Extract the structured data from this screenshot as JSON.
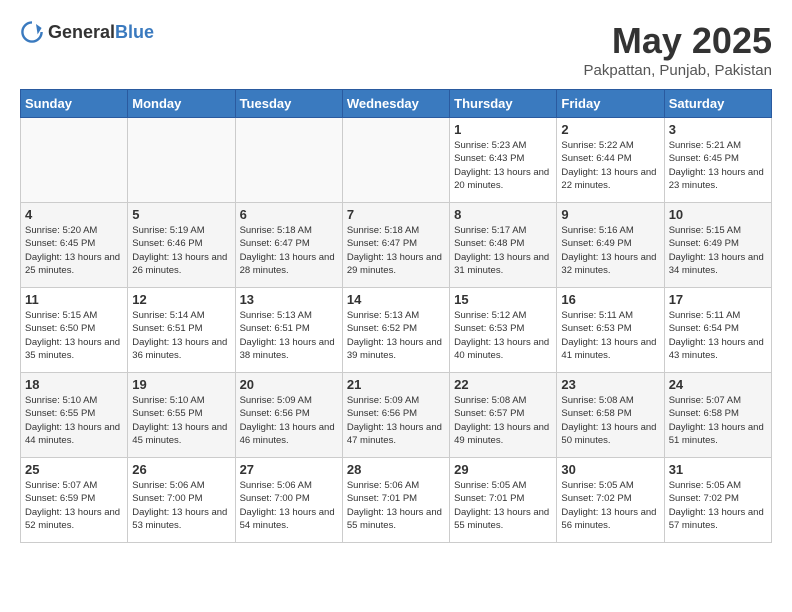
{
  "logo": {
    "general": "General",
    "blue": "Blue"
  },
  "title": {
    "month_year": "May 2025",
    "location": "Pakpattan, Punjab, Pakistan"
  },
  "headers": [
    "Sunday",
    "Monday",
    "Tuesday",
    "Wednesday",
    "Thursday",
    "Friday",
    "Saturday"
  ],
  "weeks": [
    [
      {
        "day": "",
        "info": ""
      },
      {
        "day": "",
        "info": ""
      },
      {
        "day": "",
        "info": ""
      },
      {
        "day": "",
        "info": ""
      },
      {
        "day": "1",
        "info": "Sunrise: 5:23 AM\nSunset: 6:43 PM\nDaylight: 13 hours and 20 minutes."
      },
      {
        "day": "2",
        "info": "Sunrise: 5:22 AM\nSunset: 6:44 PM\nDaylight: 13 hours and 22 minutes."
      },
      {
        "day": "3",
        "info": "Sunrise: 5:21 AM\nSunset: 6:45 PM\nDaylight: 13 hours and 23 minutes."
      }
    ],
    [
      {
        "day": "4",
        "info": "Sunrise: 5:20 AM\nSunset: 6:45 PM\nDaylight: 13 hours and 25 minutes."
      },
      {
        "day": "5",
        "info": "Sunrise: 5:19 AM\nSunset: 6:46 PM\nDaylight: 13 hours and 26 minutes."
      },
      {
        "day": "6",
        "info": "Sunrise: 5:18 AM\nSunset: 6:47 PM\nDaylight: 13 hours and 28 minutes."
      },
      {
        "day": "7",
        "info": "Sunrise: 5:18 AM\nSunset: 6:47 PM\nDaylight: 13 hours and 29 minutes."
      },
      {
        "day": "8",
        "info": "Sunrise: 5:17 AM\nSunset: 6:48 PM\nDaylight: 13 hours and 31 minutes."
      },
      {
        "day": "9",
        "info": "Sunrise: 5:16 AM\nSunset: 6:49 PM\nDaylight: 13 hours and 32 minutes."
      },
      {
        "day": "10",
        "info": "Sunrise: 5:15 AM\nSunset: 6:49 PM\nDaylight: 13 hours and 34 minutes."
      }
    ],
    [
      {
        "day": "11",
        "info": "Sunrise: 5:15 AM\nSunset: 6:50 PM\nDaylight: 13 hours and 35 minutes."
      },
      {
        "day": "12",
        "info": "Sunrise: 5:14 AM\nSunset: 6:51 PM\nDaylight: 13 hours and 36 minutes."
      },
      {
        "day": "13",
        "info": "Sunrise: 5:13 AM\nSunset: 6:51 PM\nDaylight: 13 hours and 38 minutes."
      },
      {
        "day": "14",
        "info": "Sunrise: 5:13 AM\nSunset: 6:52 PM\nDaylight: 13 hours and 39 minutes."
      },
      {
        "day": "15",
        "info": "Sunrise: 5:12 AM\nSunset: 6:53 PM\nDaylight: 13 hours and 40 minutes."
      },
      {
        "day": "16",
        "info": "Sunrise: 5:11 AM\nSunset: 6:53 PM\nDaylight: 13 hours and 41 minutes."
      },
      {
        "day": "17",
        "info": "Sunrise: 5:11 AM\nSunset: 6:54 PM\nDaylight: 13 hours and 43 minutes."
      }
    ],
    [
      {
        "day": "18",
        "info": "Sunrise: 5:10 AM\nSunset: 6:55 PM\nDaylight: 13 hours and 44 minutes."
      },
      {
        "day": "19",
        "info": "Sunrise: 5:10 AM\nSunset: 6:55 PM\nDaylight: 13 hours and 45 minutes."
      },
      {
        "day": "20",
        "info": "Sunrise: 5:09 AM\nSunset: 6:56 PM\nDaylight: 13 hours and 46 minutes."
      },
      {
        "day": "21",
        "info": "Sunrise: 5:09 AM\nSunset: 6:56 PM\nDaylight: 13 hours and 47 minutes."
      },
      {
        "day": "22",
        "info": "Sunrise: 5:08 AM\nSunset: 6:57 PM\nDaylight: 13 hours and 49 minutes."
      },
      {
        "day": "23",
        "info": "Sunrise: 5:08 AM\nSunset: 6:58 PM\nDaylight: 13 hours and 50 minutes."
      },
      {
        "day": "24",
        "info": "Sunrise: 5:07 AM\nSunset: 6:58 PM\nDaylight: 13 hours and 51 minutes."
      }
    ],
    [
      {
        "day": "25",
        "info": "Sunrise: 5:07 AM\nSunset: 6:59 PM\nDaylight: 13 hours and 52 minutes."
      },
      {
        "day": "26",
        "info": "Sunrise: 5:06 AM\nSunset: 7:00 PM\nDaylight: 13 hours and 53 minutes."
      },
      {
        "day": "27",
        "info": "Sunrise: 5:06 AM\nSunset: 7:00 PM\nDaylight: 13 hours and 54 minutes."
      },
      {
        "day": "28",
        "info": "Sunrise: 5:06 AM\nSunset: 7:01 PM\nDaylight: 13 hours and 55 minutes."
      },
      {
        "day": "29",
        "info": "Sunrise: 5:05 AM\nSunset: 7:01 PM\nDaylight: 13 hours and 55 minutes."
      },
      {
        "day": "30",
        "info": "Sunrise: 5:05 AM\nSunset: 7:02 PM\nDaylight: 13 hours and 56 minutes."
      },
      {
        "day": "31",
        "info": "Sunrise: 5:05 AM\nSunset: 7:02 PM\nDaylight: 13 hours and 57 minutes."
      }
    ]
  ]
}
